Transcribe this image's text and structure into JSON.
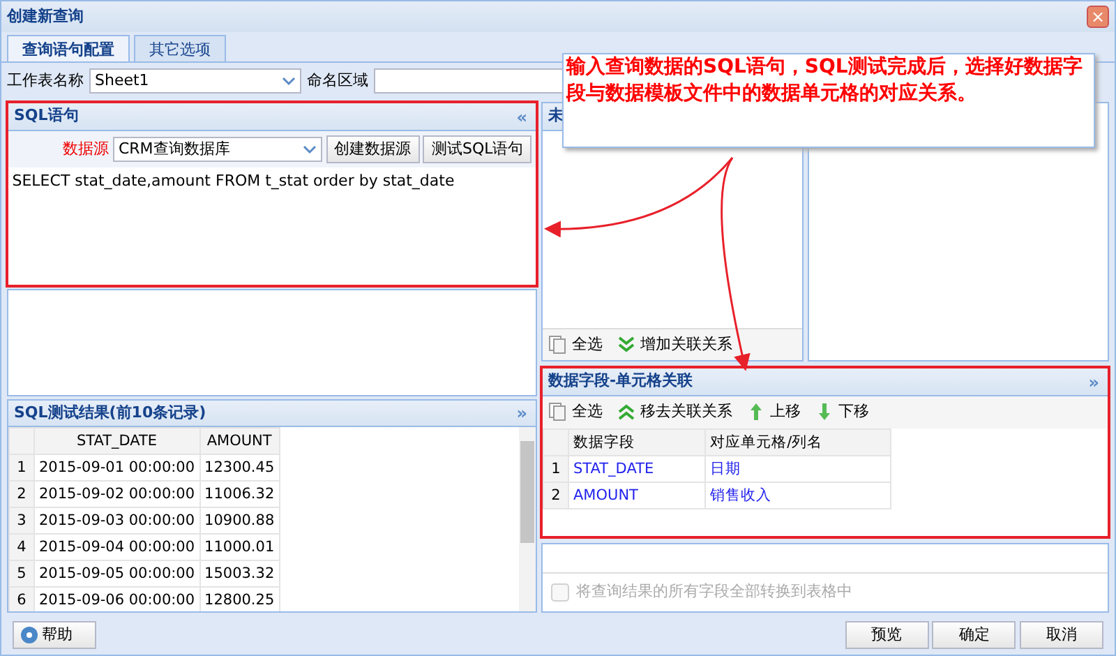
{
  "window": {
    "title": "创建新查询",
    "close": "×"
  },
  "tabs": [
    {
      "label": "查询语句配置",
      "selected": true
    },
    {
      "label": "其它选项",
      "selected": false
    }
  ],
  "form": {
    "sheet_label": "工作表名称",
    "sheet_value": "Sheet1",
    "range_label": "命名区域"
  },
  "sql_panel": {
    "title": "SQL语句",
    "collapse": "«",
    "datasource_label": "数据源",
    "datasource_value": "CRM查询数据库",
    "buttons": [
      "创建数据源",
      "测试SQL语句"
    ],
    "sql": "SELECT stat_date,amount FROM t_stat order by stat_date"
  },
  "result_panel": {
    "title": "SQL测试结果(前10条记录)",
    "collapse": "»",
    "columns": [
      "STAT_DATE",
      "AMOUNT"
    ],
    "rows": [
      {
        "index": "1",
        "cells": [
          "2015-09-01 00:00:00",
          "12300.45"
        ]
      },
      {
        "index": "2",
        "cells": [
          "2015-09-02 00:00:00",
          "11006.32"
        ]
      },
      {
        "index": "3",
        "cells": [
          "2015-09-03 00:00:00",
          "10900.88"
        ]
      },
      {
        "index": "4",
        "cells": [
          "2015-09-04 00:00:00",
          "11000.01"
        ]
      },
      {
        "index": "5",
        "cells": [
          "2015-09-05 00:00:00",
          "15003.32"
        ]
      },
      {
        "index": "6",
        "cells": [
          "2015-09-06 00:00:00",
          "12800.25"
        ]
      }
    ]
  },
  "fields_panel": {
    "title": "未",
    "toolbar": [
      {
        "kind": "select-all",
        "label": "全选"
      },
      {
        "kind": "down",
        "label": "增加关联关系"
      }
    ]
  },
  "mapping_panel": {
    "title": "数据字段-单元格关联",
    "collapse": "»",
    "toolbar": [
      {
        "kind": "select-all",
        "label": "全选"
      },
      {
        "kind": "up",
        "label": "移去关联关系"
      },
      {
        "kind": "move-up",
        "label": "上移"
      },
      {
        "kind": "move-down",
        "label": "下移"
      }
    ],
    "columns": [
      "数据字段",
      "对应单元格/列名"
    ],
    "rows": [
      {
        "index": "1",
        "cells": [
          "STAT_DATE",
          "日期"
        ]
      },
      {
        "index": "2",
        "cells": [
          "AMOUNT",
          "销售收入"
        ]
      }
    ]
  },
  "convert_all": {
    "label": "将查询结果的所有字段全部转换到表格中",
    "checked": false,
    "disabled": true
  },
  "footer": {
    "help": "帮助",
    "buttons": [
      "预览",
      "确定",
      "取消"
    ]
  },
  "callout": "输入查询数据的SQL语句，SQL测试完成后，选择好数据字段与数据模板文件中的数据单元格的对应关系。"
}
